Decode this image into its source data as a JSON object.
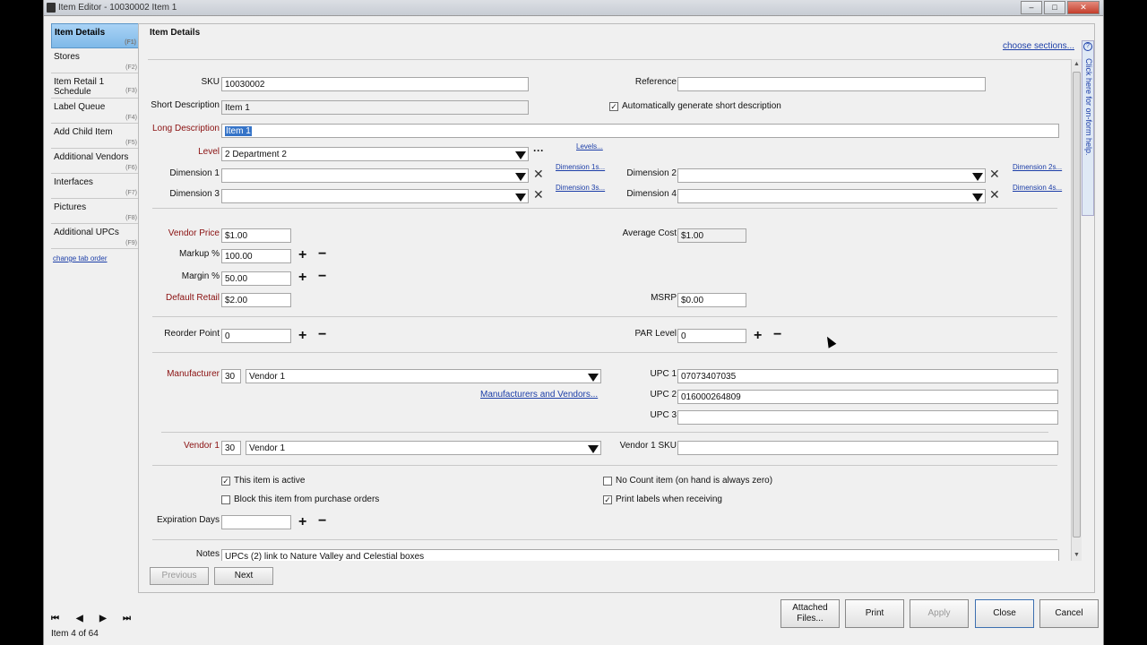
{
  "window": {
    "title": "Item Editor - 10030002 Item 1"
  },
  "sidebar": {
    "items": [
      {
        "label": "Item Details",
        "fkey": "(F1)"
      },
      {
        "label": "Stores",
        "fkey": "(F2)"
      },
      {
        "label": "Item Retail 1 Schedule",
        "fkey": "(F3)"
      },
      {
        "label": "Label Queue",
        "fkey": "(F4)"
      },
      {
        "label": "Add Child Item",
        "fkey": "(F5)"
      },
      {
        "label": "Additional Vendors",
        "fkey": "(F6)"
      },
      {
        "label": "Interfaces",
        "fkey": "(F7)"
      },
      {
        "label": "Pictures",
        "fkey": "(F8)"
      },
      {
        "label": "Additional UPCs",
        "fkey": "(F9)"
      }
    ],
    "change_tab_order": "change tab order"
  },
  "panel": {
    "title": "Item Details",
    "choose_sections": "choose sections...",
    "help": "Click here for on-form help."
  },
  "form": {
    "sku_label": "SKU",
    "sku": "10030002",
    "reference_label": "Reference",
    "reference": "",
    "short_desc_label": "Short Description",
    "short_desc": "Item 1",
    "auto_short_label": "Automatically generate short description",
    "long_desc_label": "Long Description",
    "long_desc": "Item 1",
    "level_label": "Level",
    "level": "2 Department 2",
    "levels_link": "Levels...",
    "dim1_label": "Dimension 1",
    "dim1_link": "Dimension 1s...",
    "dim2_label": "Dimension 2",
    "dim2_link": "Dimension 2s...",
    "dim3_label": "Dimension 3",
    "dim3_link": "Dimension 3s...",
    "dim4_label": "Dimension 4",
    "dim4_link": "Dimension 4s...",
    "vendor_price_label": "Vendor Price",
    "vendor_price": "$1.00",
    "avg_cost_label": "Average Cost",
    "avg_cost": "$1.00",
    "markup_label": "Markup %",
    "markup": "100.00",
    "margin_label": "Margin %",
    "margin": "50.00",
    "default_retail_label": "Default Retail",
    "default_retail": "$2.00",
    "msrp_label": "MSRP",
    "msrp": "$0.00",
    "reorder_label": "Reorder Point",
    "reorder": "0",
    "par_label": "PAR Level",
    "par": "0",
    "manufacturer_label": "Manufacturer",
    "manufacturer_code": "30",
    "manufacturer": "Vendor 1",
    "mfr_link": "Manufacturers and Vendors...",
    "upc1_label": "UPC 1",
    "upc1": "07073407035",
    "upc2_label": "UPC 2",
    "upc2": "016000264809",
    "upc3_label": "UPC 3",
    "upc3": "",
    "vendor1_label": "Vendor 1",
    "vendor1_code": "30",
    "vendor1": "Vendor 1",
    "vendor1_sku_label": "Vendor 1 SKU",
    "vendor1_sku": "",
    "active_label": "This item is active",
    "block_label": "Block this item from purchase orders",
    "nocount_label": "No Count item (on hand is always zero)",
    "printlabels_label": "Print labels when receiving",
    "expiration_label": "Expiration Days",
    "expiration": "",
    "notes_label": "Notes",
    "notes": "UPCs (2) link to Nature Valley and Celestial boxes"
  },
  "nav": {
    "previous": "Previous",
    "next": "Next"
  },
  "buttons": {
    "attached": "Attached Files...",
    "print": "Print",
    "apply": "Apply",
    "close": "Close",
    "cancel": "Cancel"
  },
  "record": {
    "count": "Item 4 of 64"
  }
}
